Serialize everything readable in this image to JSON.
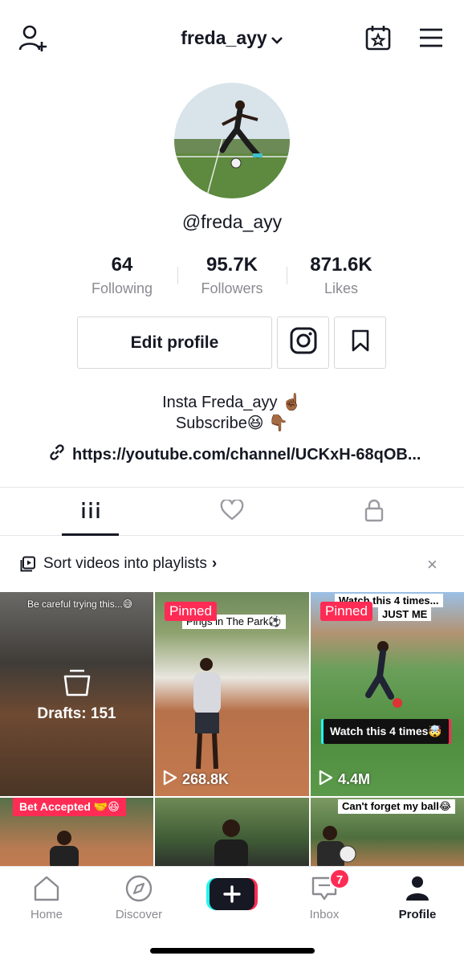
{
  "header": {
    "username": "freda_ayy",
    "icons": {
      "left": "add-user-icon",
      "calendar": "calendar-star-icon",
      "menu": "hamburger-menu-icon"
    }
  },
  "profile": {
    "handle": "@freda_ayy",
    "stats": [
      {
        "value": "64",
        "label": "Following"
      },
      {
        "value": "95.7K",
        "label": "Followers"
      },
      {
        "value": "871.6K",
        "label": "Likes"
      }
    ],
    "edit_label": "Edit profile",
    "bio_line1": "Insta Freda_ayy ☝🏾",
    "bio_line2": "Subscribe😆 👇🏾",
    "link": "https://youtube.com/channel/UCKxH-68qOB..."
  },
  "tabs": [
    "videos-grid-icon",
    "liked-heart-icon",
    "private-lock-icon"
  ],
  "playlist": {
    "text": "Sort videos into playlists",
    "chevron": "›",
    "close": "×"
  },
  "videos": [
    {
      "caption": "Be careful trying this...😅",
      "drafts_label": "Drafts: 151"
    },
    {
      "pinned": "Pinned",
      "caption": "Pings in The Park⚽",
      "views": "268.8K"
    },
    {
      "pinned": "Pinned",
      "caption": "Watch this 4 times...",
      "caption2": "JUST ME",
      "overlay": "Watch this 4 times🤯",
      "views": "4.4M"
    },
    {
      "overlay": "Bet Accepted 🤝😆"
    },
    {},
    {
      "caption": "Can't forget my ball😂"
    }
  ],
  "nav": {
    "home": "Home",
    "discover": "Discover",
    "inbox": "Inbox",
    "inbox_badge": "7",
    "profile": "Profile"
  },
  "colors": {
    "accent": "#fe2c55",
    "cyan": "#25f4ee",
    "text": "#161823",
    "muted": "#8a8b91"
  }
}
